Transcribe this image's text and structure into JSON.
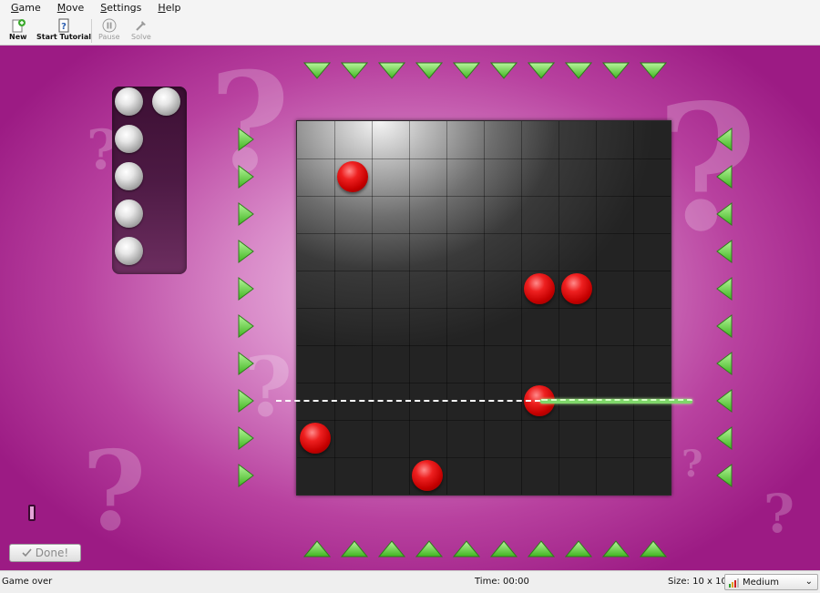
{
  "menu": [
    {
      "label": "Game",
      "mnemonic": "G",
      "rest": "ame"
    },
    {
      "label": "Move",
      "mnemonic": "M",
      "rest": "ove"
    },
    {
      "label": "Settings",
      "mnemonic": "S",
      "rest": "ettings"
    },
    {
      "label": "Help",
      "mnemonic": "H",
      "rest": "elp"
    }
  ],
  "toolbar": {
    "new_label": "New",
    "tutorial_label": "Start Tutorial",
    "pause_label": "Pause",
    "solve_label": "Solve"
  },
  "done_label": "Done!",
  "status": {
    "message": "Game over",
    "time": "Time: 00:00",
    "size": "Size: 10 x 10",
    "difficulty": "Medium"
  },
  "board": {
    "rows": 10,
    "cols": 10,
    "balls": [
      [
        1,
        1
      ],
      [
        4,
        6
      ],
      [
        4,
        7
      ],
      [
        7,
        6
      ],
      [
        8,
        0
      ],
      [
        9,
        3
      ]
    ],
    "laser_row": 7
  },
  "tray": {
    "balls_remaining": 6
  },
  "colors": {
    "background": "#b8419f",
    "ball_red": "#e01818",
    "arrow_green": "#5fd03a",
    "laser_green": "#7fd66a"
  },
  "icons": {
    "new": "new-game-icon",
    "tutorial": "tutorial-icon",
    "pause": "pause-icon",
    "solve": "solve-icon",
    "done": "checkmark-icon",
    "difficulty": "signal-bars-icon"
  }
}
